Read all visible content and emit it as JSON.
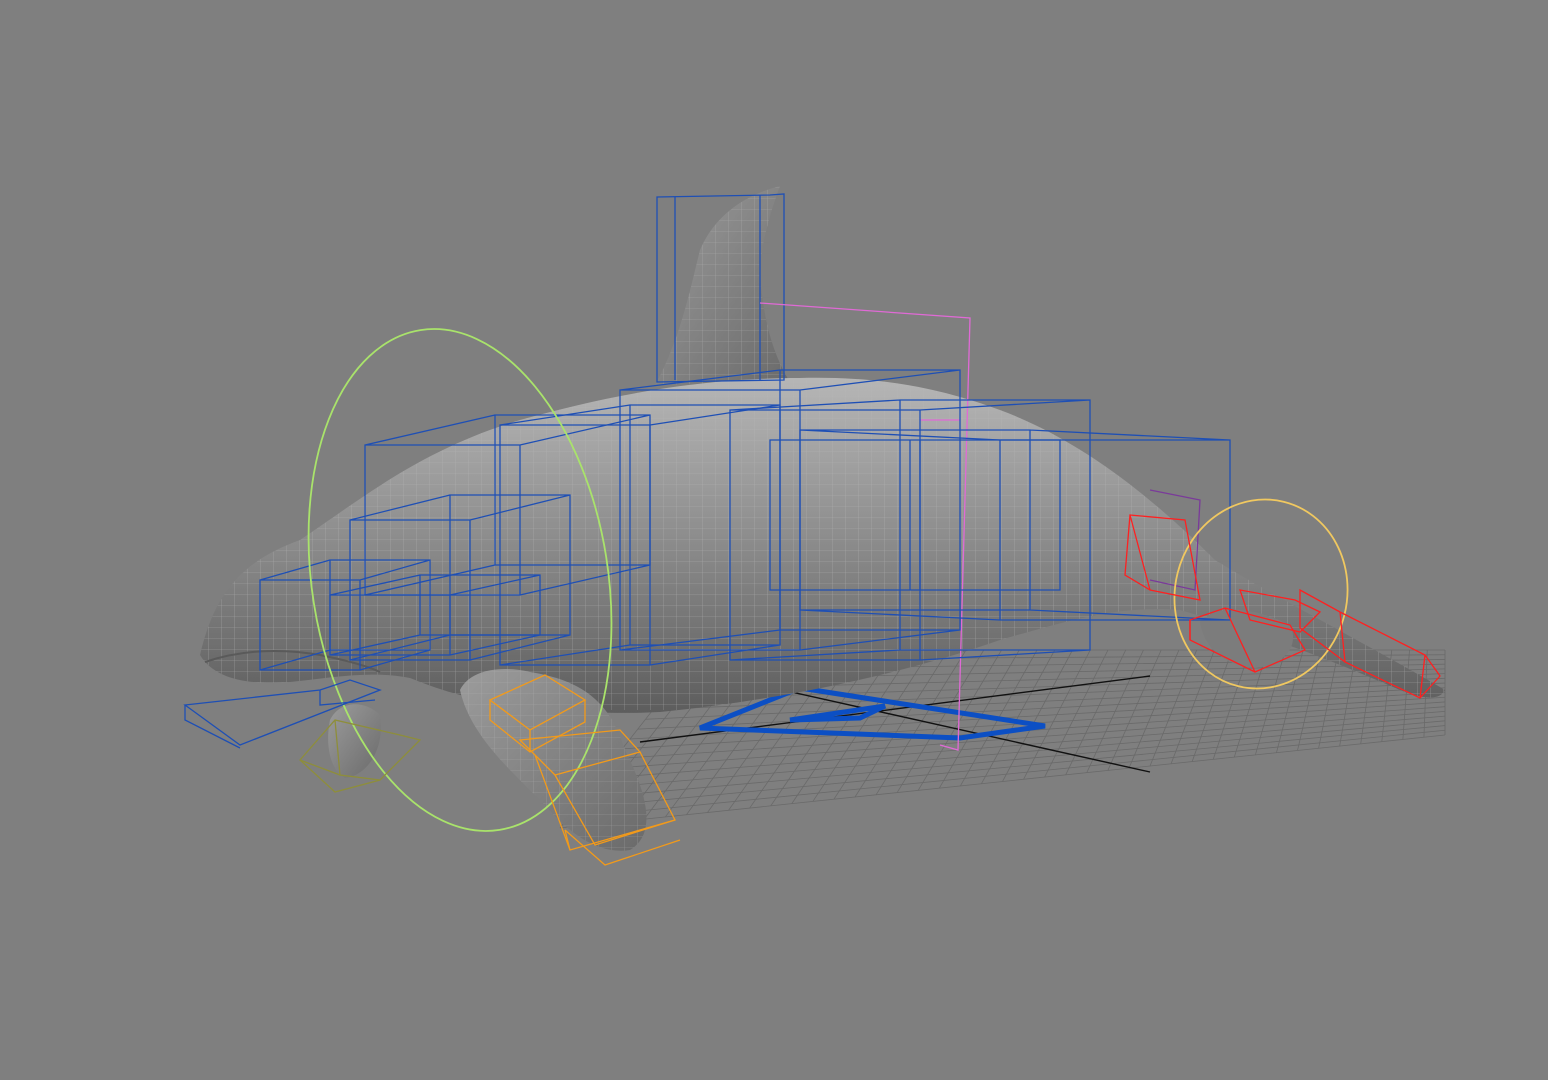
{
  "viewport": {
    "background": "#7f7f7f"
  },
  "model": {
    "body_color": "#8c8c8c",
    "wire_color": "#b2b2b2"
  },
  "colors": {
    "grid": "#6a6a6a",
    "axis": "#111111",
    "spine_controls": "#1e4fb5",
    "head_ring": "#a9e36b",
    "flipper_controls": "#f29a1a",
    "fluke_controls": "#ff2020",
    "tail_ring": "#f0c860",
    "dorsal_frame": "#e06ad6",
    "pelvic_controls": "#8e8e3a",
    "tail_base_control": "#7a3a9a",
    "root_control": "#0c4fc4"
  },
  "controls": [
    {
      "name": "root-control",
      "type": "triangle"
    },
    {
      "name": "head-rotation-ring",
      "type": "circle"
    },
    {
      "name": "tail-rotation-ring",
      "type": "circle"
    },
    {
      "name": "dorsal-fin-control",
      "type": "box"
    },
    {
      "name": "spine-controls",
      "type": "box-chain"
    },
    {
      "name": "jaw-control",
      "type": "box"
    },
    {
      "name": "pectoral-flipper-control",
      "type": "box-chain"
    },
    {
      "name": "fluke-controls",
      "type": "box-chain"
    },
    {
      "name": "pelvic-control",
      "type": "box"
    }
  ]
}
